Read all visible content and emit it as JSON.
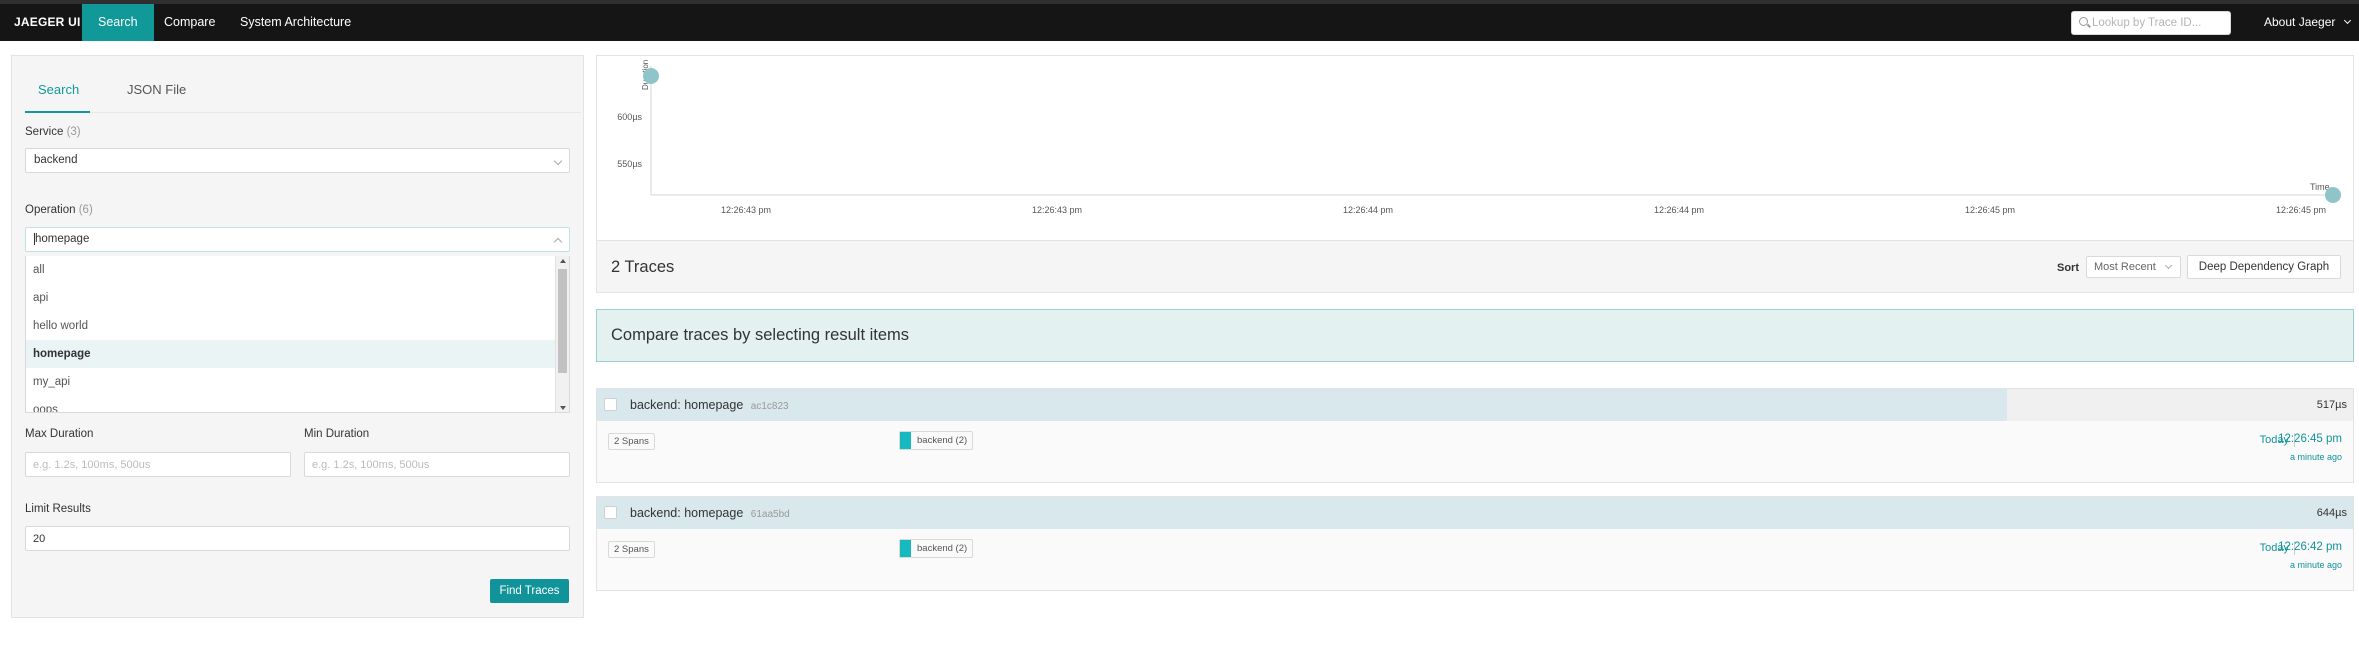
{
  "nav": {
    "brand": "JAEGER UI",
    "links": [
      "Search",
      "Compare",
      "System Architecture"
    ],
    "lookup_placeholder": "Lookup by Trace ID...",
    "about": "About Jaeger"
  },
  "search": {
    "tabs": [
      "Search",
      "JSON File"
    ],
    "service_label": "Service",
    "service_count": "(3)",
    "service_value": "backend",
    "operation_label": "Operation",
    "operation_count": "(6)",
    "operation_value": "homepage",
    "operation_options": [
      "all",
      "api",
      "hello world",
      "homepage",
      "my_api",
      "oops"
    ],
    "selected_option": "homepage",
    "max_duration_label": "Max Duration",
    "max_duration_placeholder": "e.g. 1.2s, 100ms, 500us",
    "min_duration_label": "Min Duration",
    "min_duration_placeholder": "e.g. 1.2s, 100ms, 500us",
    "limit_label": "Limit Results",
    "limit_value": "20",
    "find_button": "Find Traces"
  },
  "chart": {
    "y_label": "Duration",
    "x_label": "Time",
    "y_ticks": [
      "600µs",
      "550µs"
    ],
    "x_ticks": [
      "12:26:43 pm",
      "12:26:43 pm",
      "12:26:44 pm",
      "12:26:44 pm",
      "12:26:45 pm",
      "12:26:45 pm"
    ],
    "point_color": "#8fc4c8"
  },
  "results": {
    "count_label": "2 Traces",
    "sort_label": "Sort",
    "sort_value": "Most Recent",
    "ddg_button": "Deep Dependency Graph",
    "compare_banner": "Compare traces by selecting result items"
  },
  "traces": [
    {
      "title": "backend: homepage",
      "trace_id": "ac1c823",
      "duration": "517µs",
      "duration_fraction": 0.803,
      "spans": "2 Spans",
      "service": "backend (2)",
      "day": "Today",
      "time": "12:26:45 pm",
      "ago": "a minute ago"
    },
    {
      "title": "backend: homepage",
      "trace_id": "61aa5bd",
      "duration": "644µs",
      "duration_fraction": 1.0,
      "spans": "2 Spans",
      "service": "backend (2)",
      "day": "Today",
      "time": "12:26:42 pm",
      "ago": "a minute ago"
    }
  ],
  "colors": {
    "accent": "#199",
    "service": "#17b8be"
  }
}
